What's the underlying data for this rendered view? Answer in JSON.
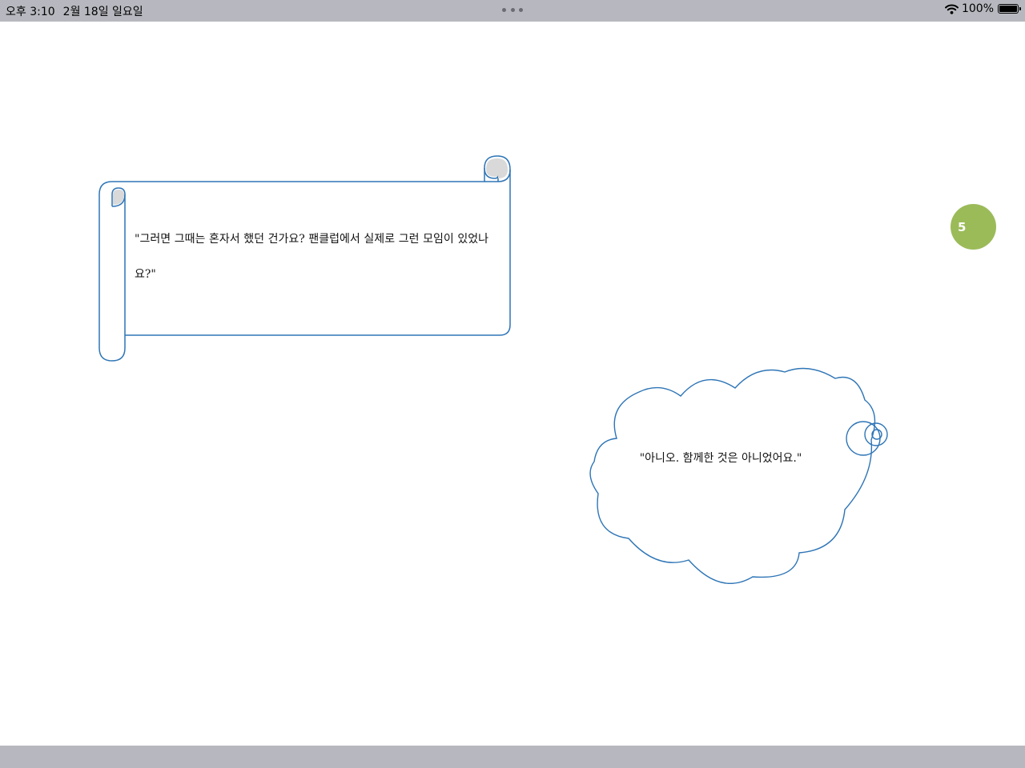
{
  "status_bar": {
    "time": "오후 3:10",
    "date": "2월 18일 일요일",
    "battery": "100%",
    "icons": [
      "more-dots-icon",
      "wifi-icon",
      "battery-icon"
    ]
  },
  "page": {
    "number": "5",
    "badge_color": "#9bbb59"
  },
  "scroll_banner": {
    "text": "\"그러면 그때는 혼자서 했던 건가요? 팬클럽에서 실제로 그런 모임이 있었나요?\"",
    "outline_color": "#2e75b6",
    "curl_fill": "#d9d9d9"
  },
  "cloud_callout": {
    "text": "\"아니오. 함께한 것은 아니었어요.\"",
    "outline_color": "#2e75b6"
  }
}
